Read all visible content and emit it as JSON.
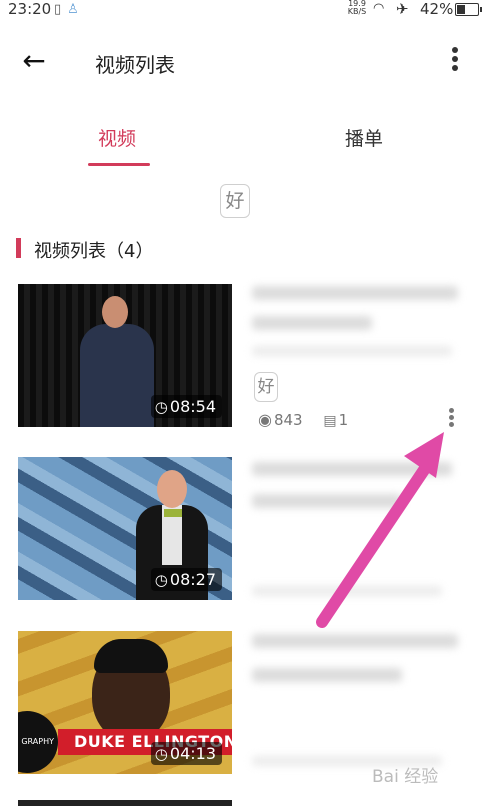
{
  "status_bar": {
    "time": "23:20",
    "speed": "19.9 KB/S",
    "battery": "42%"
  },
  "header": {
    "title": "视频列表"
  },
  "tabs": [
    {
      "label": "视频",
      "active": true
    },
    {
      "label": "播单",
      "active": false
    }
  ],
  "badge": "好",
  "section": {
    "title": "视频列表（4）"
  },
  "videos": [
    {
      "duration": "08:54",
      "views": "843",
      "comments": "1"
    },
    {
      "duration": "08:27"
    },
    {
      "duration": "04:13",
      "banner": "DUKE ELLINGTON",
      "tag": "GRAPHY"
    }
  ],
  "colors": {
    "accent": "#d23b5a",
    "arrow": "#e04aa6"
  },
  "watermark": "Bai 经验"
}
